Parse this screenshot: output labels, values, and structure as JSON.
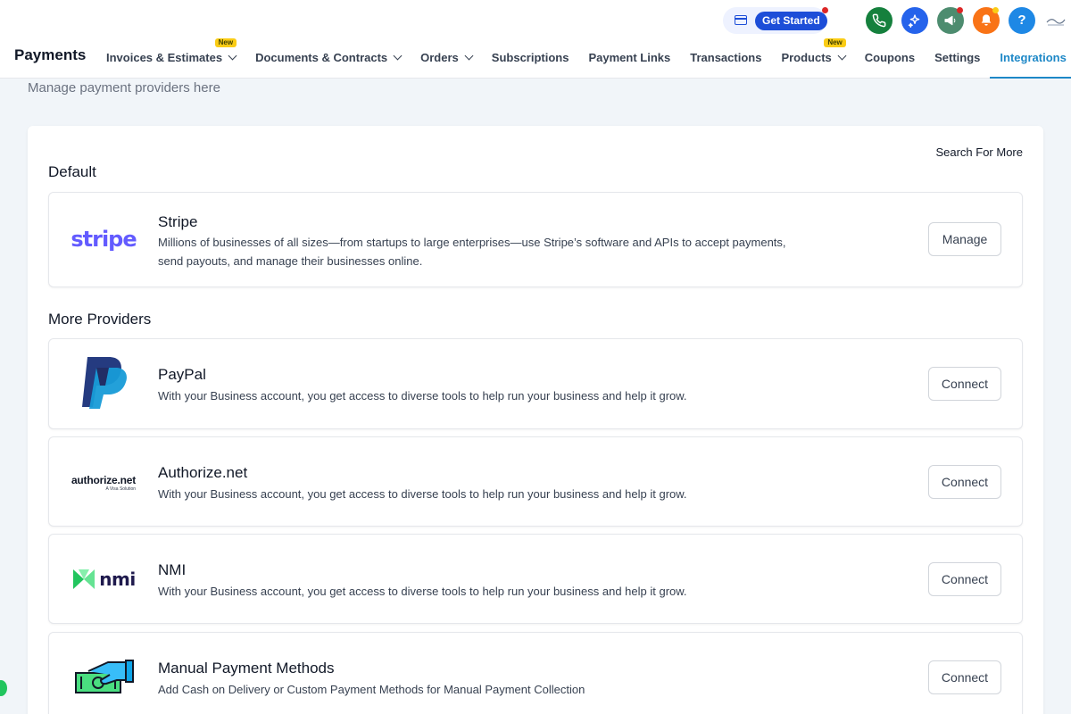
{
  "header": {
    "get_started_label": "Get Started",
    "brand": "Payments",
    "help_label": "?",
    "icons": [
      "card-icon",
      "phone-icon",
      "sparkle-icon",
      "megaphone-icon",
      "bell-icon",
      "help-icon"
    ],
    "colors": {
      "phone": "#15803d",
      "sparkle": "#2563eb",
      "megaphone": "#4d8c6f",
      "bell": "#f97316",
      "help": "#1e88e5",
      "active_tab": "#1e88c7",
      "badge": "#facc15"
    }
  },
  "nav": [
    {
      "label": "Invoices & Estimates",
      "badge": "New"
    },
    {
      "label": "Documents & Contracts"
    },
    {
      "label": "Orders"
    },
    {
      "label": "Subscriptions"
    },
    {
      "label": "Payment Links"
    },
    {
      "label": "Transactions"
    },
    {
      "label": "Products",
      "badge": "New"
    },
    {
      "label": "Coupons"
    },
    {
      "label": "Settings"
    },
    {
      "label": "Integrations",
      "active": true
    }
  ],
  "page": {
    "subtitle": "Manage payment providers here",
    "search_more": "Search For More",
    "default_title": "Default",
    "more_title": "More Providers"
  },
  "providers": [
    {
      "name": "Stripe",
      "logo_text": "stripe",
      "desc_line1": "Millions of businesses of all sizes—from startups to large enterprises—use Stripe’s software and APIs to accept payments,",
      "desc_line2": "send payouts, and manage their businesses online.",
      "action": "Manage"
    },
    {
      "name": "PayPal",
      "desc": "With your Business account, you get access to diverse tools to help run your business and help it grow.",
      "action": "Connect"
    },
    {
      "name": "Authorize.net",
      "logo_text": "authorize.net",
      "logo_sub": "A Visa Solution",
      "desc": "With your Business account, you get access to diverse tools to help run your business and help it grow.",
      "action": "Connect"
    },
    {
      "name": "NMI",
      "logo_text": "nmi",
      "desc": "With your Business account, you get access to diverse tools to help run your business and help it grow.",
      "action": "Connect"
    },
    {
      "name": "Manual Payment Methods",
      "desc": "Add Cash on Delivery or Custom Payment Methods for Manual Payment Collection",
      "action": "Connect"
    }
  ]
}
